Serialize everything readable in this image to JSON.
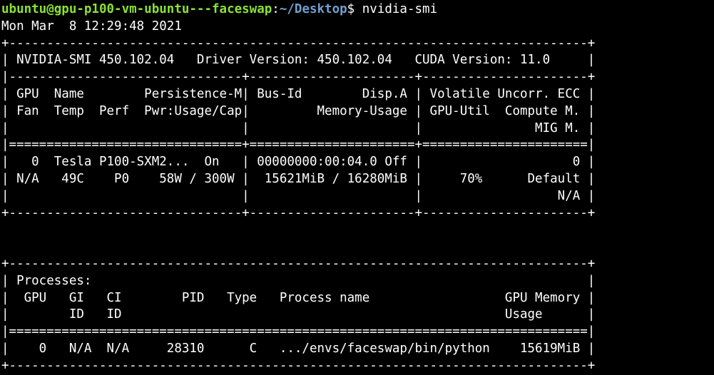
{
  "colors": {
    "background": "#000000",
    "foreground": "#ffffff",
    "prompt_user": "#8ae234",
    "prompt_path": "#729fcf"
  },
  "prompt": {
    "user_host": "ubuntu@gpu-p100-vm-ubuntu---faceswap",
    "separator": ":",
    "path": "~/Desktop",
    "symbol": "$ ",
    "command": "nvidia-smi"
  },
  "output": {
    "timestamp": "Mon Mar  8 12:29:48 2021",
    "lines": [
      "+-----------------------------------------------------------------------------+",
      "| NVIDIA-SMI 450.102.04   Driver Version: 450.102.04   CUDA Version: 11.0     |",
      "|-------------------------------+----------------------+----------------------+",
      "| GPU  Name        Persistence-M| Bus-Id        Disp.A | Volatile Uncorr. ECC |",
      "| Fan  Temp  Perf  Pwr:Usage/Cap|         Memory-Usage | GPU-Util  Compute M. |",
      "|                               |                      |               MIG M. |",
      "|===============================+======================+======================|",
      "|   0  Tesla P100-SXM2...  On   | 00000000:00:04.0 Off |                    0 |",
      "| N/A   49C    P0    58W / 300W |  15621MiB / 16280MiB |     70%      Default |",
      "|                               |                      |                  N/A |",
      "+-------------------------------+----------------------+----------------------+",
      "",
      "",
      "+-----------------------------------------------------------------------------+",
      "| Processes:                                                                  |",
      "|  GPU   GI   CI        PID   Type   Process name                  GPU Memory |",
      "|        ID   ID                                                   Usage      |",
      "|=============================================================================|",
      "|    0   N/A  N/A     28310      C   .../envs/faceswap/bin/python    15619MiB |",
      "+-----------------------------------------------------------------------------+"
    ]
  }
}
